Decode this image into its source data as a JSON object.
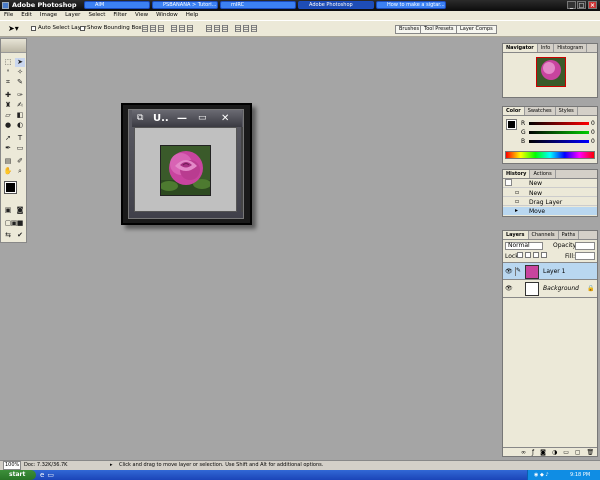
{
  "app": {
    "title": "Adobe Photoshop"
  },
  "menu": [
    "File",
    "Edit",
    "Image",
    "Layer",
    "Select",
    "Filter",
    "View",
    "Window",
    "Help"
  ],
  "options": {
    "auto_select_label": "Auto Select Layer",
    "bounding_box_label": "Show Bounding Box",
    "wells": [
      "Brushes",
      "Tool Presets",
      "Layer Comps"
    ]
  },
  "document": {
    "title": "U.."
  },
  "navigator": {
    "tabs": [
      "Navigator",
      "Info",
      "Histogram"
    ]
  },
  "color": {
    "tabs": [
      "Color",
      "Swatches",
      "Styles"
    ],
    "channels": [
      {
        "name": "R",
        "value": "0",
        "color": "#e02020"
      },
      {
        "name": "G",
        "value": "0",
        "color": "#20b020"
      },
      {
        "name": "B",
        "value": "0",
        "color": "#2050e0"
      }
    ]
  },
  "history": {
    "tabs": [
      "History",
      "Actions"
    ],
    "items": [
      {
        "label": "New",
        "selected": false
      },
      {
        "label": "New",
        "selected": false
      },
      {
        "label": "Drag Layer",
        "selected": false
      },
      {
        "label": "Move",
        "selected": true
      }
    ]
  },
  "layers": {
    "tabs": [
      "Layers",
      "Channels",
      "Paths"
    ],
    "blend_mode": "Normal",
    "opacity_label": "Opacity:",
    "lock_label": "Lock:",
    "fill_label": "Fill:",
    "items": [
      {
        "name": "Layer 1",
        "selected": true
      },
      {
        "name": "Background",
        "selected": false
      }
    ]
  },
  "status": {
    "zoom": "100%",
    "doc": "Doc: 7.32K/36.7K",
    "hint": "Click and drag to move layer or selection.  Use Shift and Alt for additional options."
  },
  "taskbar": {
    "start": "start",
    "tasks": [
      {
        "label": "AIM",
        "active": false
      },
      {
        "label": "PSBANANA > Tutori...",
        "active": false
      },
      {
        "label": "mIRC",
        "active": false
      },
      {
        "label": "Adobe Photoshop",
        "active": true
      },
      {
        "label": "How to make a sigtar...",
        "active": false
      }
    ],
    "clock": "9:18 PM"
  },
  "colors": {
    "accent": "#0a246a",
    "selection": "#b9d7f0",
    "taskbar": "#2457c8"
  }
}
